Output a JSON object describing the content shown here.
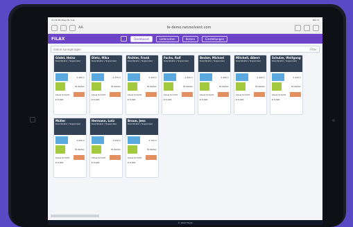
{
  "statusbar": {
    "time": "11:00 Montag 28. Aug.",
    "battery": "100 %"
  },
  "browser": {
    "url": "fe-demo.netzsolvent.com",
    "aa": "AA"
  },
  "app": {
    "brand": "FILAX",
    "tabs": [
      {
        "label": "Dashboard",
        "active": true
      },
      {
        "label": "Lieferanten",
        "active": false
      },
      {
        "label": "Kosten",
        "active": false
      },
      {
        "label": "Einstellungen",
        "active": false
      }
    ]
  },
  "search": {
    "value": "online kunngeragen",
    "filter_label": "Filter"
  },
  "cards": [
    {
      "title": "Gödel, Heinz",
      "subtitle": "Koordinator / Supervisor",
      "capacity": "2.400 h",
      "remaining": "34 Zeiten",
      "badge": "€ 6.000",
      "tag": "blaue Schicht"
    },
    {
      "title": "Dietz, Mika",
      "subtitle": "Koordinator / Supervisor",
      "capacity": "2.375 h",
      "remaining": "34 Zeiten",
      "badge": "€ 6.000",
      "tag": "blaue Schicht"
    },
    {
      "title": "Richter, Frank",
      "subtitle": "Koordinator / Supervisor",
      "capacity": "2.410 h",
      "remaining": "34 Zeiten",
      "badge": "€ 6.000",
      "tag": "blaue Schicht"
    },
    {
      "title": "Fuchs, Ralf",
      "subtitle": "Koordinator / Supervisor",
      "capacity": "2.425 h",
      "remaining": "34 Zeiten",
      "badge": "€ 6.000",
      "tag": "blaue Schicht"
    },
    {
      "title": "Becker, Michael",
      "subtitle": "Koordinator / Supervisor",
      "capacity": "2.400 h",
      "remaining": "34 Zeiten",
      "badge": "€ 6.000",
      "tag": "blaue Schicht"
    },
    {
      "title": "Mitchell, Albert",
      "subtitle": "Koordinator / Supervisor",
      "capacity": "2.400 h",
      "remaining": "34 Zeiten",
      "badge": "€ 6.000",
      "tag": "blaue Schicht"
    },
    {
      "title": "Schulze, Wolfgang",
      "subtitle": "Koordinator / Supervisor",
      "capacity": "2.410 h",
      "remaining": "34 Zeiten",
      "badge": "€ 6.000",
      "tag": "blaue Schicht"
    },
    {
      "title": "Müller",
      "subtitle": "Koordinator / Supervisor",
      "capacity": "2.000 h",
      "remaining": "34 Zeiten",
      "badge": "€ 6.000",
      "tag": "blaue Schicht"
    },
    {
      "title": "Hermann, Lutz",
      "subtitle": "Koordinator / Supervisor",
      "capacity": "2.000 h",
      "remaining": "34 Zeiten",
      "badge": "€ 6.000",
      "tag": "blaue Schicht"
    },
    {
      "title": "Braun, Jens",
      "subtitle": "Koordinator / Supervisor",
      "capacity": "2.125 h",
      "remaining": "34 Zeiten",
      "badge": "€ 6.000",
      "tag": "blaue Schicht"
    }
  ],
  "footer": {
    "text": "© 2023 FILAX"
  }
}
